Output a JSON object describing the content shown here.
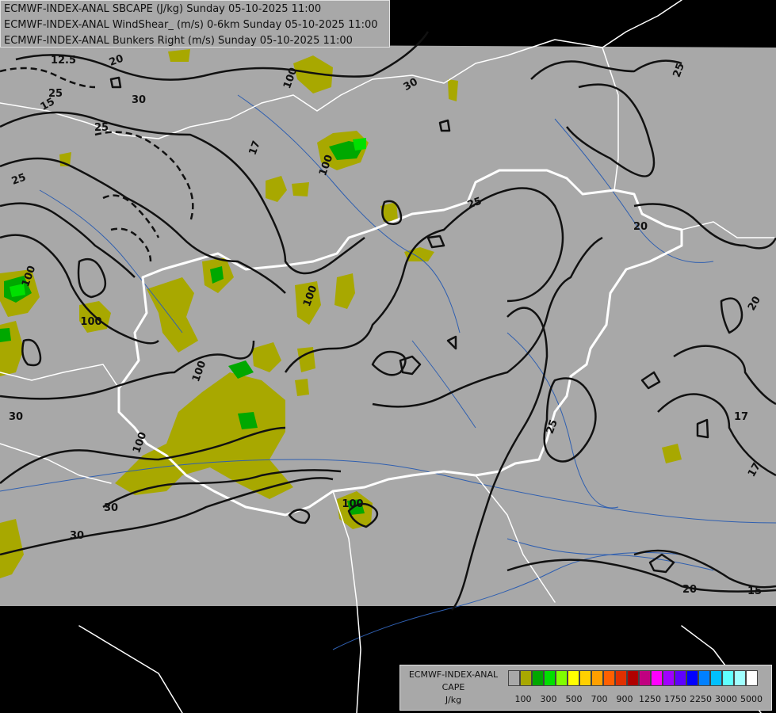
{
  "header": {
    "line1": "ECMWF-INDEX-ANAL SBCAPE (J/kg) Sunday 05-10-2025 11:00",
    "line2": "ECMWF-INDEX-ANAL WindShear_ (m/s) 0-6km Sunday 05-10-2025 11:00",
    "line3": "ECMWF-INDEX-ANAL Bunkers Right (m/s) Sunday 05-10-2025 11:00"
  },
  "legend": {
    "title1": "ECMWF-INDEX-ANAL",
    "title2": "CAPE",
    "units": "J/kg",
    "colors": [
      "#a8a8a8",
      "#a8a800",
      "#00a800",
      "#00e000",
      "#80ff00",
      "#ffff00",
      "#ffd000",
      "#ffa000",
      "#ff6000",
      "#e03000",
      "#b00000",
      "#c00080",
      "#ff00ff",
      "#a000ff",
      "#6000ff",
      "#0000ff",
      "#0080ff",
      "#00c0ff",
      "#60ffff",
      "#a0ffff",
      "#ffffff"
    ],
    "ticks": [
      "100",
      "300",
      "500",
      "700",
      "900",
      "1250",
      "1750",
      "2250",
      "3000",
      "5000"
    ]
  },
  "map": {
    "land_color": "#a8a8a8",
    "cape_color": "#a8a800",
    "cape_high_color": "#00a800",
    "border_color": "#ffffff",
    "river_color": "#2f5fb0",
    "contour_labels": [
      "12.5",
      "20",
      "25",
      "15",
      "25",
      "30",
      "30",
      "25",
      "100",
      "25",
      "17",
      "100",
      "30",
      "20",
      "100",
      "100",
      "100",
      "100",
      "100",
      "20",
      "17",
      "17",
      "25",
      "30",
      "25",
      "100",
      "30",
      "20",
      "15"
    ]
  }
}
